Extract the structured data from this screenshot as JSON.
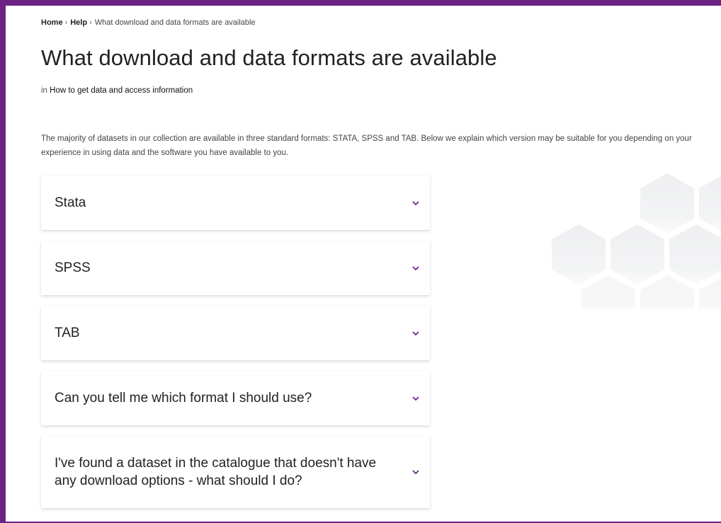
{
  "breadcrumb": {
    "home": "Home",
    "help": "Help",
    "separator": "›",
    "current": "What download and data formats are available"
  },
  "page": {
    "title": "What download and data formats are available",
    "category_prefix": "in",
    "category_link": "How to get data and access information",
    "intro": "The majority of datasets in our collection are available in three standard formats: STATA, SPSS and TAB. Below we explain which version may be suitable for you depending on your experience in using data and the software you have available to you."
  },
  "accordion": {
    "items": [
      {
        "label": "Stata"
      },
      {
        "label": "SPSS"
      },
      {
        "label": "TAB"
      },
      {
        "label": "Can you tell me which format I should use?"
      },
      {
        "label": "I've found a dataset in the catalogue that doesn't have any download options - what should I do?"
      }
    ]
  },
  "colors": {
    "accent": "#6c2383",
    "chevron": "#6c2383",
    "hexagon": "#f2f3f4"
  },
  "icons": {
    "chevron": "chevron-down-icon",
    "decoration": "hexagon-pattern"
  }
}
